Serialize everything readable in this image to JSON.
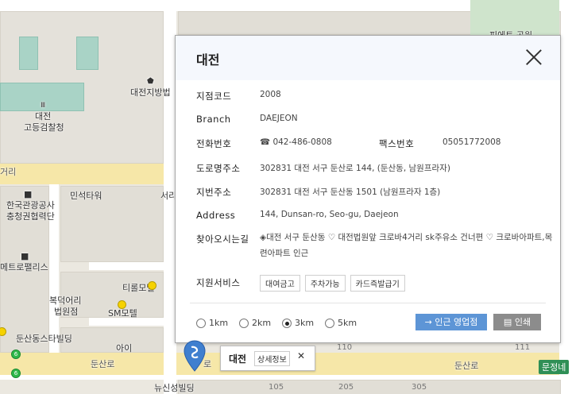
{
  "map": {
    "labels": {
      "prosecutor_1": "대전",
      "prosecutor_2": "고등검찰청",
      "court": "대전지방법",
      "pet_park": "피에트 공원",
      "tourism_1": "한국관광공사",
      "tourism_2": "충청권협력단",
      "minseok": "민석타워",
      "seori": "서리",
      "metro": "메트로팰리스",
      "tiffany": "티롤모텔",
      "bokdeok_1": "복덕어리",
      "bokdeok_2": "법원점",
      "sm": "SM모텔",
      "dunsan_studio": "둔산동스타빌딩",
      "ai": "아이",
      "dunsan_road_1": "둔산로",
      "dunsan_road_2": "둔산로",
      "road_left": "거리",
      "road_sign": "문정네",
      "nyushin": "뉴신성빌딩",
      "num_110": "110",
      "num_111": "111",
      "num_105": "105",
      "num_205": "205",
      "num_305": "305",
      "num_6a": "6",
      "num_6b": "6",
      "road_mid": "로"
    },
    "colors": {
      "road": "#ffffff",
      "yellow_road": "#f6e7a8",
      "building": "#a9d3c6",
      "green": "#cfe4cc"
    }
  },
  "popup": {
    "title": "대전",
    "fields": {
      "code_label": "지점코드",
      "code_value": "2008",
      "branch_label": "Branch",
      "branch_value": "DAEJEON",
      "phone_label": "전화번호",
      "phone_icon": "☎",
      "phone_value": "042-486-0808",
      "fax_label": "팩스번호",
      "fax_value": "05051772008",
      "road_addr_label": "도로명주소",
      "road_addr_value": "302831 대전 서구 둔산로 144, (둔산동, 남원프라자)",
      "lot_addr_label": "지번주소",
      "lot_addr_value": "302831 대전 서구 둔산동 1501 (남원프라자 1층)",
      "address_label": "Address",
      "address_value": "144, Dunsan-ro, Seo-gu, Daejeon",
      "directions_label": "찾아오시는길",
      "directions_value": "◈대전 서구 둔산동 ♡ 대전법원앞 크로바4거리 sk주유소 건너편 ♡ 크로바아파트,목련아파트 인근",
      "services_label": "지원서비스",
      "services": [
        "대여금고",
        "주차가능",
        "카드즉발급기"
      ]
    },
    "radius": {
      "options": [
        "1km",
        "2km",
        "3km",
        "5km"
      ],
      "selected": "3km"
    },
    "nearby_button": "→ 인근 영업점",
    "print_button": "인쇄",
    "print_icon": "print-icon"
  },
  "marker": {
    "name": "대전",
    "detail_button": "상세정보",
    "close_glyph": "✕"
  }
}
